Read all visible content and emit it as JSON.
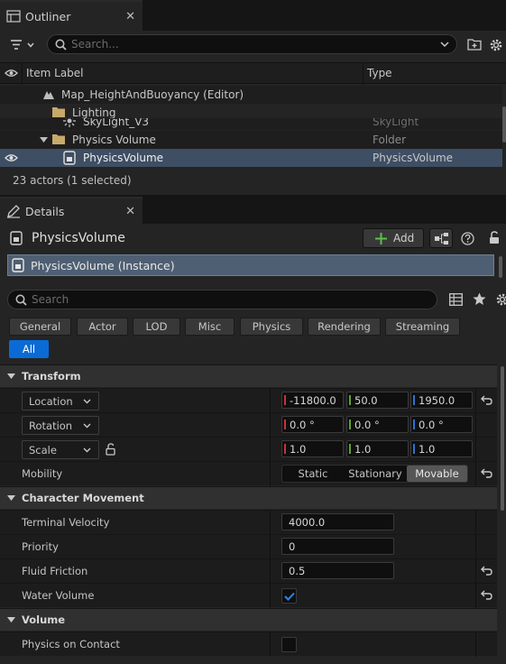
{
  "outliner": {
    "tab_label": "Outliner",
    "close_glyph": "✕",
    "search_placeholder": "Search...",
    "col_item_label": "Item Label",
    "col_type": "Type",
    "rows": [
      {
        "label": "Map_HeightAndBuoyancy (Editor)",
        "type": ""
      },
      {
        "label": "Lighting",
        "type": ""
      },
      {
        "label": "SkyLight_V3",
        "type": "SkyLight"
      },
      {
        "label": "Physics Volume",
        "type": "Folder"
      },
      {
        "label": "PhysicsVolume",
        "type": "PhysicsVolume"
      }
    ],
    "status": "23 actors (1 selected)"
  },
  "details": {
    "tab_label": "Details",
    "close_glyph": "✕",
    "actor_name": "PhysicsVolume",
    "add_label": "Add",
    "instance_label": "PhysicsVolume (Instance)",
    "search_placeholder": "Search",
    "filters": [
      "General",
      "Actor",
      "LOD",
      "Misc",
      "Physics",
      "Rendering",
      "Streaming",
      "All"
    ],
    "transform": {
      "category": "Transform",
      "location_label": "Location",
      "location": [
        "-11800.0",
        "50.0",
        "1950.0"
      ],
      "rotation_label": "Rotation",
      "rotation": [
        "0.0 °",
        "0.0 °",
        "0.0 °"
      ],
      "scale_label": "Scale",
      "scale": [
        "1.0",
        "1.0",
        "1.0"
      ],
      "mobility_label": "Mobility",
      "mobility_options": [
        "Static",
        "Stationary",
        "Movable"
      ],
      "mobility_selected": "Movable"
    },
    "character_movement": {
      "category": "Character Movement",
      "terminal_velocity_label": "Terminal Velocity",
      "terminal_velocity": "4000.0",
      "priority_label": "Priority",
      "priority": "0",
      "fluid_friction_label": "Fluid Friction",
      "fluid_friction": "0.5",
      "water_volume_label": "Water Volume",
      "water_volume": true
    },
    "volume": {
      "category": "Volume",
      "physics_on_contact_label": "Physics on Contact",
      "physics_on_contact": false
    }
  },
  "colors": {
    "accent_blue": "#0a6bd6",
    "selection": "#4f5f73",
    "axis_x": "#c83434",
    "axis_y": "#5fa132",
    "axis_z": "#2f6fd6",
    "add_green": "#5cc04b"
  }
}
